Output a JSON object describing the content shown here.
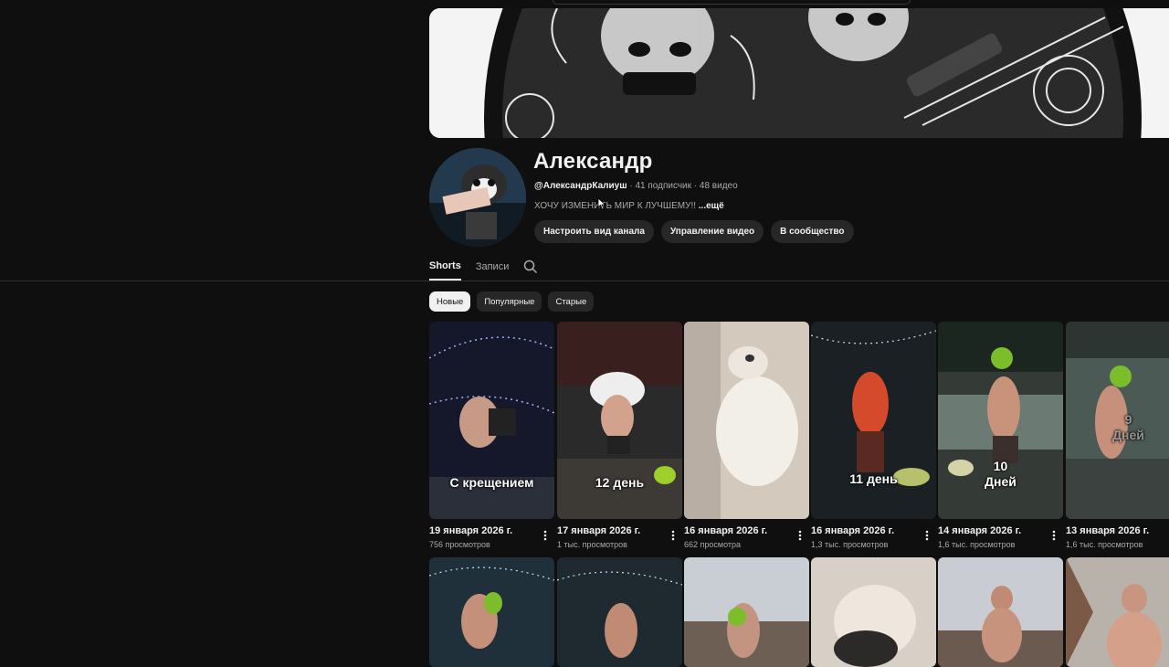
{
  "channel": {
    "name": "Александр",
    "handle": "@АлександрКалиуш",
    "stats": " · 41 подписчик · 48 видео",
    "description": "ХОЧУ ИЗМЕНИТЬ МИР К ЛУЧШЕМУ!! ",
    "more_label": "...ещё"
  },
  "actions": {
    "customize": "Настроить вид канала",
    "manage_videos": "Управление видео",
    "community": "В сообщество"
  },
  "tabs": [
    {
      "label": "Shorts",
      "active": true
    },
    {
      "label": "Записи",
      "active": false
    }
  ],
  "chips": [
    {
      "label": "Новые",
      "active": true
    },
    {
      "label": "Популярные",
      "active": false
    },
    {
      "label": "Старые",
      "active": false
    }
  ],
  "shorts": [
    {
      "overlay": "С крещением",
      "date": "19 января 2026 г.",
      "views": "756 просмотров"
    },
    {
      "overlay": "12 день",
      "date": "17 января 2026 г.",
      "views": "1 тыс. просмотров"
    },
    {
      "overlay": "",
      "date": "16 января 2026 г.",
      "views": "662 просмотра"
    },
    {
      "overlay": "11 день",
      "date": "16 января 2026 г.",
      "views": "1,3 тыс. просмотров"
    },
    {
      "overlay": "10\nДней",
      "overlay_line1": "10",
      "overlay_line2": "Дней",
      "date": "14 января 2026 г.",
      "views": "1,6 тыс. просмотров"
    },
    {
      "overlay_line1": "9",
      "overlay_line2": "Дней",
      "date": "13 января 2026 г.",
      "views": "1,6 тыс. просмотров"
    }
  ],
  "icons": {
    "search": "search-icon",
    "more": "more-vert-icon",
    "cursor": "mouse-cursor-icon"
  },
  "colors": {
    "background": "#0f0f0f",
    "chip": "#272727",
    "text_secondary": "#aaaaaa"
  }
}
